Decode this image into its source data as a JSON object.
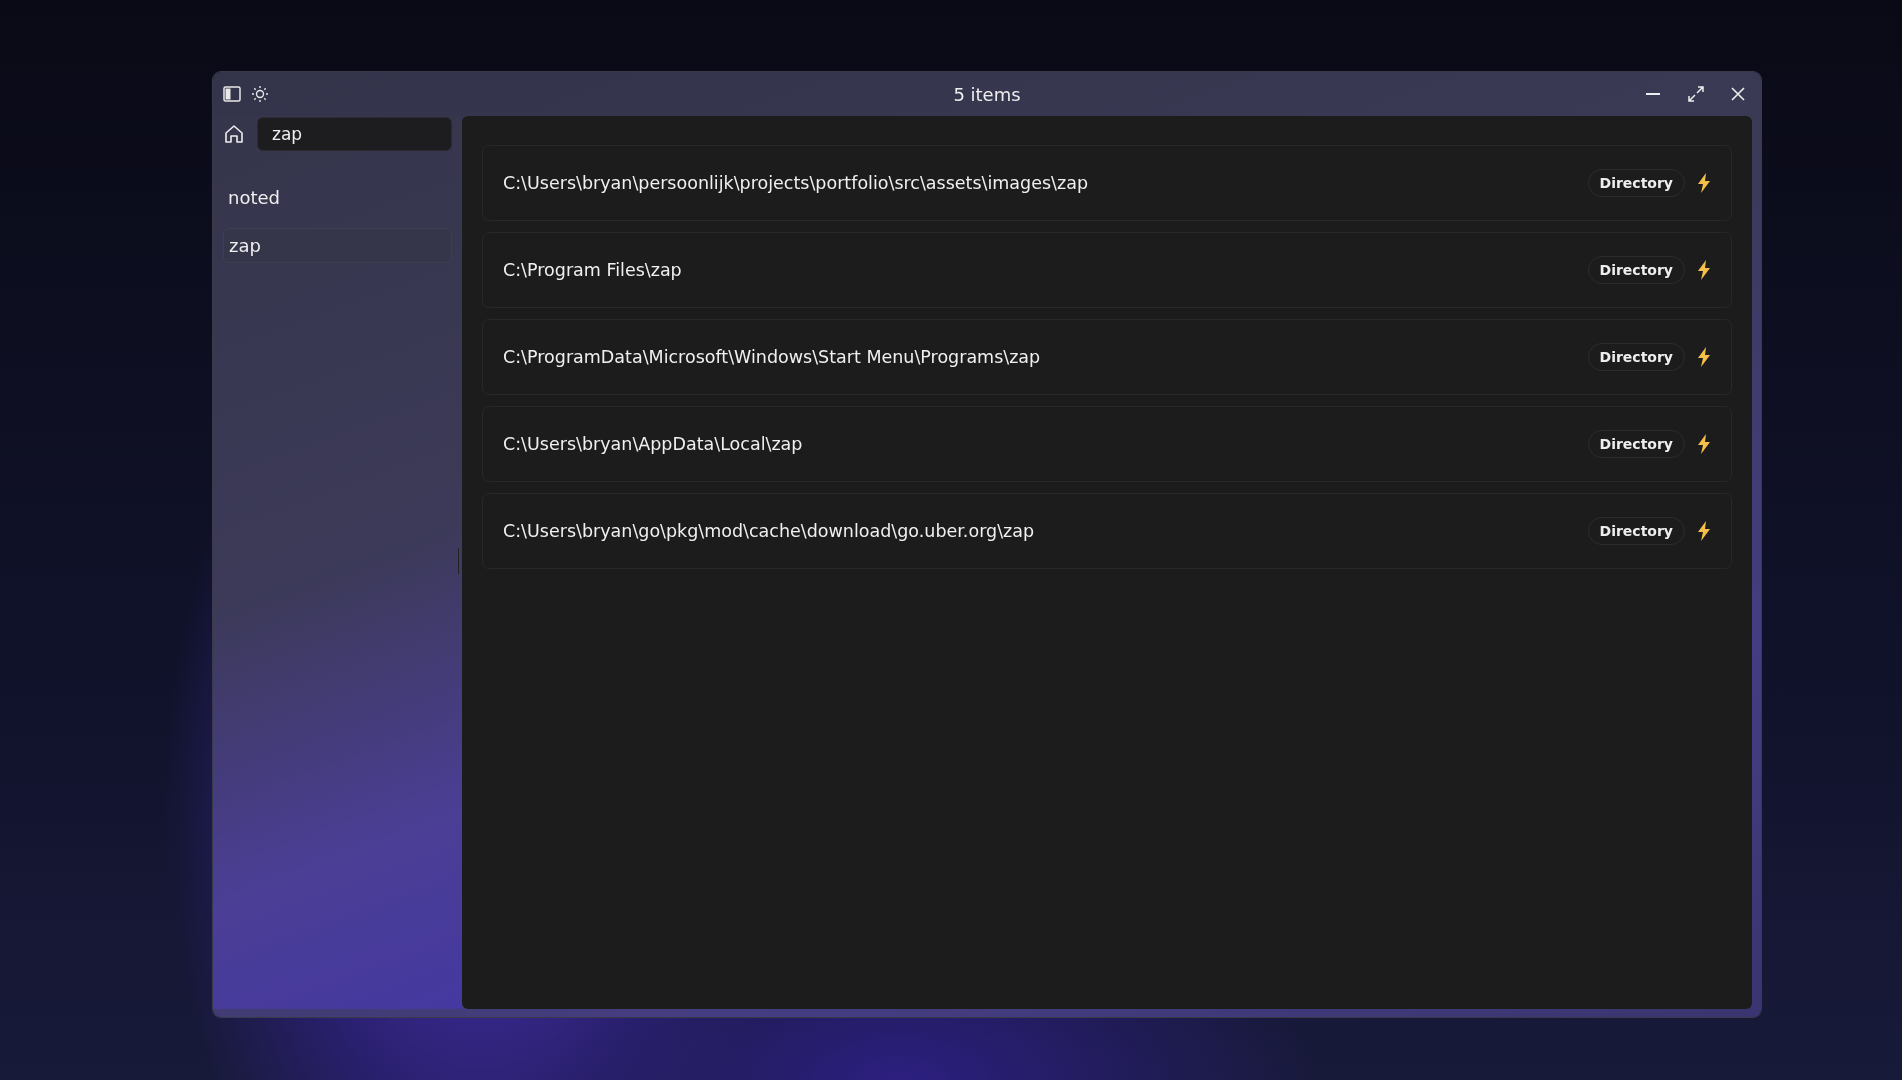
{
  "window": {
    "title": "5 items"
  },
  "sidebar": {
    "search": {
      "value": "zap"
    },
    "items": [
      {
        "label": "noted",
        "selected": false
      },
      {
        "label": "zap",
        "selected": true
      }
    ]
  },
  "results": [
    {
      "path": "C:\\Users\\bryan\\persoonlijk\\projects\\portfolio\\src\\assets\\images\\zap",
      "type": "Directory"
    },
    {
      "path": "C:\\Program Files\\zap",
      "type": "Directory"
    },
    {
      "path": "C:\\ProgramData\\Microsoft\\Windows\\Start Menu\\Programs\\zap",
      "type": "Directory"
    },
    {
      "path": "C:\\Users\\bryan\\AppData\\Local\\zap",
      "type": "Directory"
    },
    {
      "path": "C:\\Users\\bryan\\go\\pkg\\mod\\cache\\download\\go.uber.org\\zap",
      "type": "Directory"
    }
  ]
}
